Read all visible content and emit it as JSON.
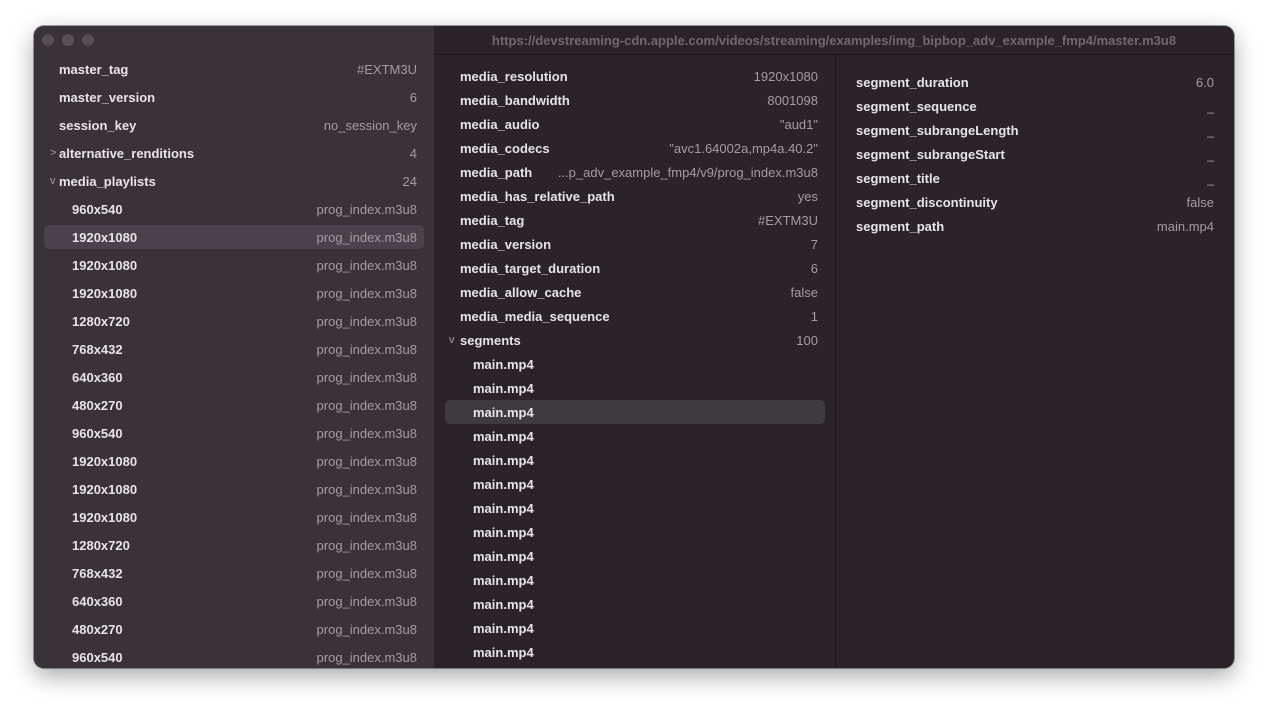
{
  "window": {
    "url": "https://devstreaming-cdn.apple.com/videos/streaming/examples/img_bipbop_adv_example_fmp4/master.m3u8"
  },
  "sidebar": {
    "fields": [
      {
        "key": "master_tag",
        "value": "#EXTM3U"
      },
      {
        "key": "master_version",
        "value": "6"
      },
      {
        "key": "session_key",
        "value": "no_session_key"
      },
      {
        "key": "alternative_renditions",
        "value": "4",
        "chevron": ">"
      },
      {
        "key": "media_playlists",
        "value": "24",
        "chevron": "v"
      }
    ],
    "playlists": [
      {
        "res": "960x540",
        "file": "prog_index.m3u8"
      },
      {
        "res": "1920x1080",
        "file": "prog_index.m3u8"
      },
      {
        "res": "1920x1080",
        "file": "prog_index.m3u8"
      },
      {
        "res": "1920x1080",
        "file": "prog_index.m3u8"
      },
      {
        "res": "1280x720",
        "file": "prog_index.m3u8"
      },
      {
        "res": "768x432",
        "file": "prog_index.m3u8"
      },
      {
        "res": "640x360",
        "file": "prog_index.m3u8"
      },
      {
        "res": "480x270",
        "file": "prog_index.m3u8"
      },
      {
        "res": "960x540",
        "file": "prog_index.m3u8"
      },
      {
        "res": "1920x1080",
        "file": "prog_index.m3u8"
      },
      {
        "res": "1920x1080",
        "file": "prog_index.m3u8"
      },
      {
        "res": "1920x1080",
        "file": "prog_index.m3u8"
      },
      {
        "res": "1280x720",
        "file": "prog_index.m3u8"
      },
      {
        "res": "768x432",
        "file": "prog_index.m3u8"
      },
      {
        "res": "640x360",
        "file": "prog_index.m3u8"
      },
      {
        "res": "480x270",
        "file": "prog_index.m3u8"
      },
      {
        "res": "960x540",
        "file": "prog_index.m3u8"
      }
    ]
  },
  "media": {
    "fields": [
      {
        "key": "media_resolution",
        "value": "1920x1080"
      },
      {
        "key": "media_bandwidth",
        "value": "8001098"
      },
      {
        "key": "media_audio",
        "value": "\"aud1\""
      },
      {
        "key": "media_codecs",
        "value": "\"avc1.64002a,mp4a.40.2\""
      },
      {
        "key": "media_path",
        "value": "...p_adv_example_fmp4/v9/prog_index.m3u8"
      },
      {
        "key": "media_has_relative_path",
        "value": "yes"
      },
      {
        "key": "media_tag",
        "value": "#EXTM3U"
      },
      {
        "key": "media_version",
        "value": "7"
      },
      {
        "key": "media_target_duration",
        "value": "6"
      },
      {
        "key": "media_allow_cache",
        "value": "false"
      },
      {
        "key": "media_media_sequence",
        "value": "1"
      }
    ],
    "segments_label": "segments",
    "segments_count": "100",
    "segments": [
      "main.mp4",
      "main.mp4",
      "main.mp4",
      "main.mp4",
      "main.mp4",
      "main.mp4",
      "main.mp4",
      "main.mp4",
      "main.mp4",
      "main.mp4",
      "main.mp4",
      "main.mp4",
      "main.mp4"
    ]
  },
  "segment": {
    "fields": [
      {
        "key": "segment_duration",
        "value": "6.0"
      },
      {
        "key": "segment_sequence",
        "value": "_"
      },
      {
        "key": "segment_subrangeLength",
        "value": "_"
      },
      {
        "key": "segment_subrangeStart",
        "value": "_"
      },
      {
        "key": "segment_title",
        "value": "_"
      },
      {
        "key": "segment_discontinuity",
        "value": "false"
      },
      {
        "key": "segment_path",
        "value": "main.mp4"
      }
    ]
  }
}
